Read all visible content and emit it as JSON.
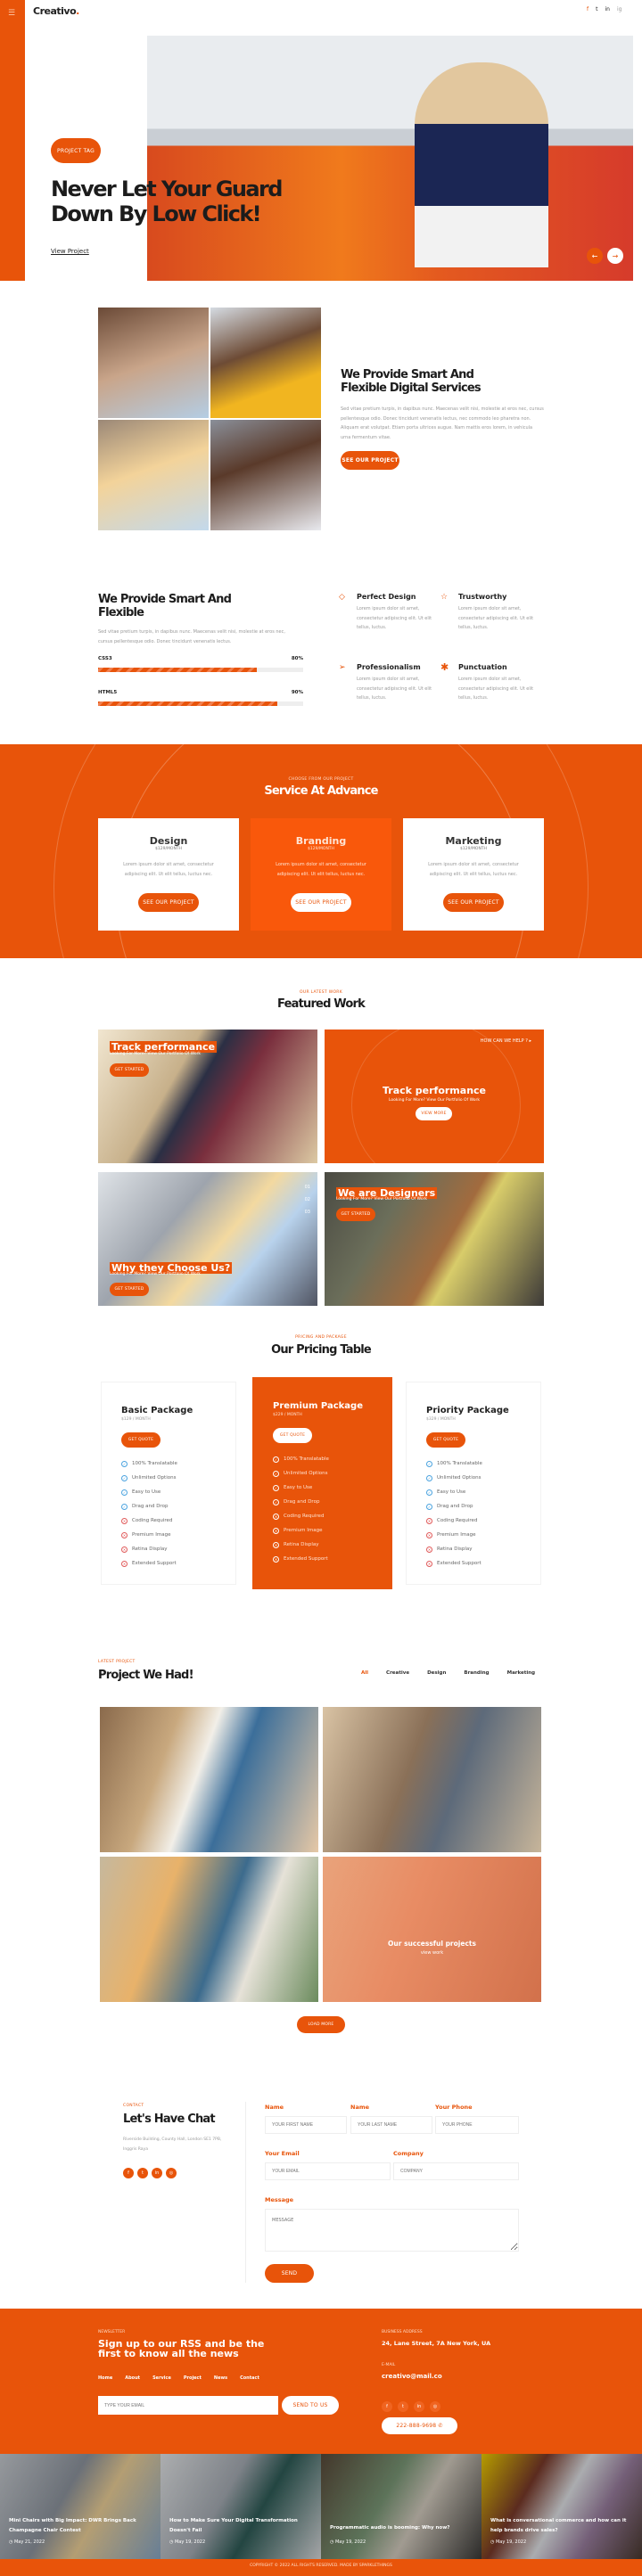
{
  "brand": {
    "logo": "Creativo",
    "logo_dot": ".",
    "accent": "#e8540a"
  },
  "header": {
    "menu_icon": "hamburger-icon",
    "social": [
      "f",
      "t",
      "in",
      "ig"
    ]
  },
  "hero": {
    "tag": "PROJECT TAG",
    "title_line1": "Never Let Your Guard",
    "title_line2": "Down By Low Click!",
    "link": "View Project"
  },
  "about": {
    "title_line1": "We Provide Smart And",
    "title_line2": "Flexible Digital Services",
    "text": "Sed vitae pretium turpis, in dapibus nunc. Maecenas velit nisi, molestie at eros nec, cursus pellentesque odio. Donec tincidunt venenatis lectus, nec commodo leo pharetra non. Aliquam erat volutpat. Etiam porta ultrices augue. Nam mattis eros lorem, in vehicula urna fermentum vitae.",
    "button": "SEE OUR PROJECT"
  },
  "skills": {
    "title_line1": "We Provide Smart And",
    "title_line2": "Flexible",
    "text": "Sed vitae pretium turpis, in dapibus nunc. Maecenas velit nisi, molestie at eros nec, cursus pellentesque odio. Donec tincidunt venenatis lectus.",
    "bars": [
      {
        "label": "CSS3",
        "percent": 80,
        "display": "80%"
      },
      {
        "label": "HTML5",
        "percent": 90,
        "display": "90%"
      }
    ],
    "features": [
      {
        "icon": "diamond-icon",
        "title": "Perfect Design",
        "text": "Lorem ipsum dolor sit amet, consectetur adipiscing elit. Ut elit tellus, luctus."
      },
      {
        "icon": "star-icon",
        "title": "Trustworthy",
        "text": "Lorem ipsum dolor sit amet, consectetur adipiscing elit. Ut elit tellus, luctus."
      },
      {
        "icon": "paper-plane-icon",
        "title": "Professionalism",
        "text": "Lorem ipsum dolor sit amet, consectetur adipiscing elit. Ut elit tellus, luctus."
      },
      {
        "icon": "asterisk-icon",
        "title": "Punctuation",
        "text": "Lorem ipsum dolor sit amet, consectetur adipiscing elit. Ut elit tellus, luctus."
      }
    ]
  },
  "services": {
    "label": "CHOOSE FROM OUR PROJECT",
    "title": "Service At Advance",
    "cards": [
      {
        "title": "Design",
        "price": "$129/MONTH",
        "text": "Lorem ipsum dolor sit amet, consectetur adipiscing elit. Ut elit tellus, luctus nec.",
        "button": "SEE OUR PROJECT"
      },
      {
        "title": "Branding",
        "price": "$129/MONTH",
        "text": "Lorem ipsum dolor sit amet, consectetur adipiscing elit. Ut elit tellus, luctus nec.",
        "button": "SEE OUR PROJECT"
      },
      {
        "title": "Marketing",
        "price": "$129/MONTH",
        "text": "Lorem ipsum dolor sit amet, consectetur adipiscing elit. Ut elit tellus, luctus nec.",
        "button": "SEE OUR PROJECT"
      }
    ]
  },
  "featured": {
    "label": "OUR LATEST WORK",
    "title": "Featured Work",
    "items": [
      {
        "title": "Track performance",
        "sub": "Looking For More? View Our Portfolio Of Work",
        "button": "GET STARTED"
      },
      {
        "title": "Track performance",
        "sub": "Looking For More? View Our Portfolio Of Work",
        "button": "VIEW MORE",
        "help": "HOW CAN WE HELP ?"
      },
      {
        "title": "Why they Choose Us?",
        "sub": "Looking For More? View Our Portfolio Of Work",
        "button": "GET STARTED",
        "pager": [
          "01",
          "02",
          "03"
        ]
      },
      {
        "title": "We are Designers",
        "sub": "Looking For More? View Our Portfolio Of Work",
        "button": "GET STARTED"
      }
    ]
  },
  "pricing": {
    "label": "PRICING AND PACKAGE",
    "title": "Our Pricing Table",
    "plans": [
      {
        "name": "Basic Package",
        "price": "$129 / MONTH",
        "button": "GET QUOTE"
      },
      {
        "name": "Premium Package",
        "price": "$229 / MONTH",
        "button": "GET QUOTE"
      },
      {
        "name": "Priority Package",
        "price": "$329 / MONTH",
        "button": "GET QUOTE"
      }
    ],
    "features": [
      {
        "text": "100% Translatable",
        "included": true
      },
      {
        "text": "Unlimited Options",
        "included": true
      },
      {
        "text": "Easy to Use",
        "included": true
      },
      {
        "text": "Drag and Drop",
        "included": true
      },
      {
        "text": "Coding Required",
        "included": false
      },
      {
        "text": "Premium Image",
        "included": false
      },
      {
        "text": "Retina Display",
        "included": false
      },
      {
        "text": "Extended Support",
        "included": false
      }
    ]
  },
  "projects": {
    "label": "LATEST PROJECT",
    "title": "Project We Had!",
    "filters": [
      "All",
      "Creative",
      "Design",
      "Branding",
      "Marketing"
    ],
    "active_filter": "All",
    "overlay_title": "Our successful projects",
    "overlay_link": "view work",
    "button": "LOAD MORE"
  },
  "contact": {
    "label": "CONTACT",
    "title": "Let's Have Chat",
    "address": "Riverside Building, County Hall, London SE1 7PB, Inggris Raya",
    "fields": [
      {
        "label": "Name",
        "placeholder": "YOUR FIRST NAME"
      },
      {
        "label": "Name",
        "placeholder": "YOUR LAST NAME"
      },
      {
        "label": "Your Phone",
        "placeholder": "YOUR PHONE"
      },
      {
        "label": "Your Email",
        "placeholder": "YOUR EMAIL"
      },
      {
        "label": "Company",
        "placeholder": "COMPANY"
      },
      {
        "label": "Message",
        "placeholder": "MESSAGE"
      }
    ],
    "button": "SEND"
  },
  "newsletter": {
    "label": "NEWSLETTER",
    "title_line1": "Sign up to our RSS and be the",
    "title_line2": "first to know all the news",
    "nav": [
      "Home",
      "About",
      "Service",
      "Project",
      "News",
      "Contact"
    ],
    "email_placeholder": "TYPE YOUR EMAIL",
    "button": "SEND TO US",
    "address_label": "BUSINESS ADDRESS",
    "address": "24, Lane Street, 7A New York, UA",
    "email_label": "E-MAIL",
    "email": "creativo@mail.co",
    "phone": "222-888-9698"
  },
  "blog": [
    {
      "title": "Mini Chairs with Big Impact: DWR Brings Back Champagne Chair Contest",
      "date": "May 21, 2022"
    },
    {
      "title": "How to Make Sure Your Digital Transformation Doesn't Fail",
      "date": "May 19, 2022"
    },
    {
      "title": "Programmatic audio is booming: Why now?",
      "date": "May 19, 2022"
    },
    {
      "title": "What is conversational commerce and how can it help brands drive sales?",
      "date": "May 19, 2022"
    }
  ],
  "footer": {
    "copyright": "COPYRIGHT © 2022 ALL RIGHTS RESERVED. MADE BY SPARKLETHINGS"
  }
}
